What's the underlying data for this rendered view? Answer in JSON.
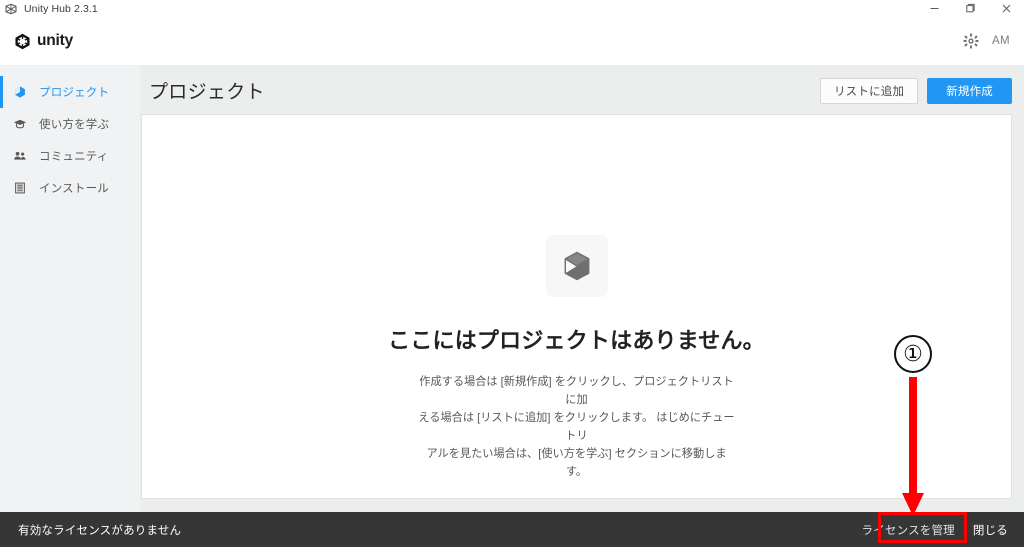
{
  "window": {
    "title": "Unity Hub 2.3.1",
    "app_icon": "unity-small-icon",
    "controls": {
      "minimize": "minimize-icon",
      "maximize": "maximize-icon",
      "close": "close-icon"
    }
  },
  "header": {
    "brand": "unity",
    "brand_mark": "unity-logo-icon",
    "settings_icon": "gear-icon",
    "avatar_initials": "AM"
  },
  "sidebar": {
    "items": [
      {
        "label": "プロジェクト",
        "icon": "cube-icon",
        "active": true
      },
      {
        "label": "使い方を学ぶ",
        "icon": "graduation-cap-icon",
        "active": false
      },
      {
        "label": "コミュニティ",
        "icon": "people-icon",
        "active": false
      },
      {
        "label": "インストール",
        "icon": "list-stack-icon",
        "active": false
      }
    ]
  },
  "main": {
    "page_title": "プロジェクト",
    "toolbar": {
      "add_to_list_label": "リストに追加",
      "new_project_label": "新規作成"
    },
    "empty_state": {
      "icon": "cube-3d-icon",
      "title": "ここにはプロジェクトはありません。",
      "description_line1": "作成する場合は [新規作成] をクリックし、プロジェクトリストに加",
      "description_line2": "える場合は [リストに追加] をクリックします。 はじめにチュートリ",
      "description_line3": "アルを見たい場合は、[使い方を学ぶ] セクションに移動します。"
    }
  },
  "license_bar": {
    "message": "有効なライセンスがありません",
    "manage_label": "ライセンスを管理",
    "close_label": "閉じる"
  },
  "annotation": {
    "step_number": "①",
    "marker_color": "#ff0000",
    "target": "ライセンスを管理"
  }
}
